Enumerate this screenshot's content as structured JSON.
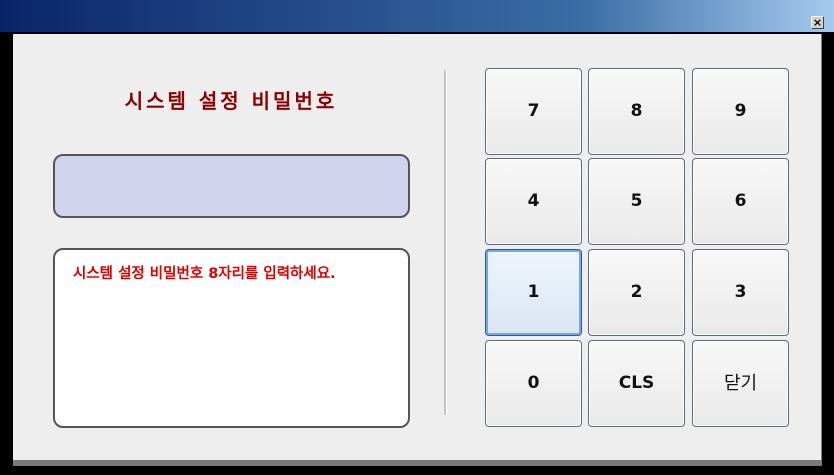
{
  "window": {
    "close_glyph": "×"
  },
  "dialog": {
    "title": "시스템 설정 비밀번호",
    "password_value": "",
    "message": "시스템 설정 비밀번호 8자리를 입력하세요."
  },
  "keypad": {
    "rows": [
      [
        "7",
        "8",
        "9"
      ],
      [
        "4",
        "5",
        "6"
      ],
      [
        "1",
        "2",
        "3"
      ],
      [
        "0",
        "CLS",
        "닫기"
      ]
    ],
    "focused_key": "1"
  },
  "colors": {
    "title_text": "#8b0000",
    "message_text": "#e00000",
    "password_box_bg": "#cfd3ee",
    "window_bg": "#eeeeee",
    "titlebar_start": "#0a246a",
    "titlebar_end": "#a6caf0"
  }
}
